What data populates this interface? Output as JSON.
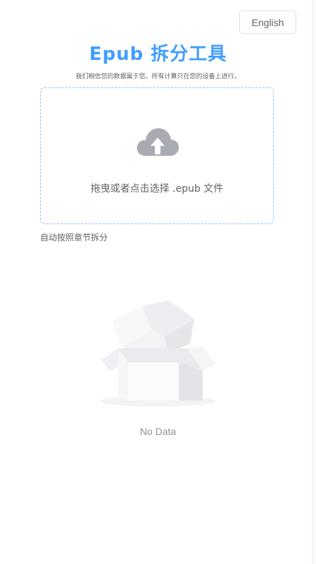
{
  "header": {
    "language_button": "English",
    "title": "Epub 拆分工具",
    "subtitle": "我们相信您的数据属于您。所有计算只在您的设备上进行。"
  },
  "upload": {
    "icon": "cloud-upload-icon",
    "prompt": "拖曳或者点击选择 .epub 文件"
  },
  "options": {
    "auto_split_label": "自动按照章节拆分"
  },
  "result": {
    "empty_icon": "empty-box-icon",
    "empty_text": "No Data"
  },
  "colors": {
    "accent": "#409eff",
    "dropzone_border": "#8fc1f5",
    "icon_gray": "#a8abb2",
    "text_secondary": "#606266",
    "text_muted": "#909399"
  }
}
